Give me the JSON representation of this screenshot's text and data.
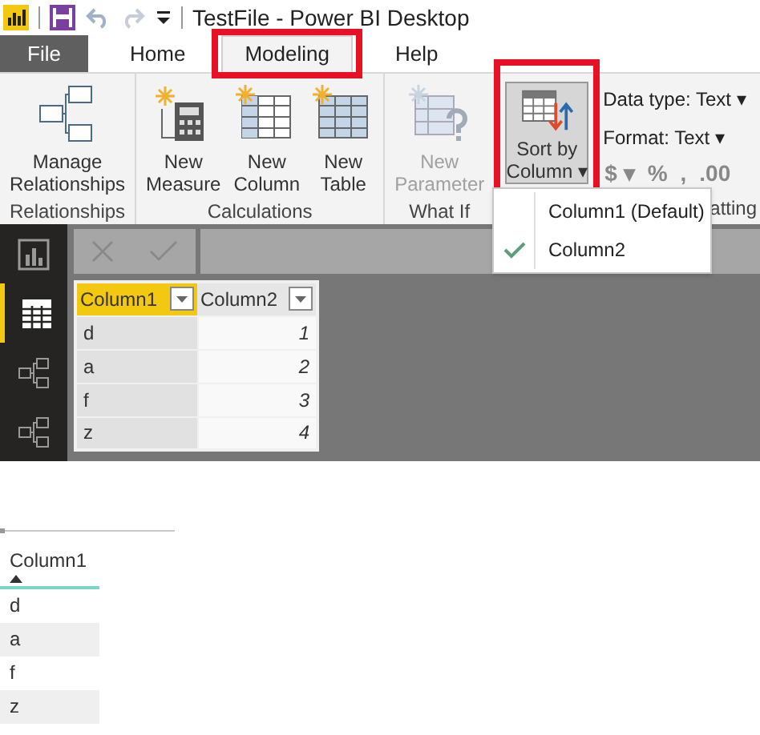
{
  "window": {
    "title": "TestFile - Power BI Desktop"
  },
  "tabs": [
    {
      "label": "File",
      "kind": "file",
      "selected": false,
      "highlighted": false
    },
    {
      "label": "Home",
      "kind": "tab",
      "selected": false,
      "highlighted": false
    },
    {
      "label": "Modeling",
      "kind": "tab",
      "selected": true,
      "highlighted": true
    },
    {
      "label": "Help",
      "kind": "tab",
      "selected": false,
      "highlighted": false
    }
  ],
  "ribbon": {
    "groups": [
      {
        "label": "Relationships",
        "buttons": [
          {
            "label": "Manage Relationships",
            "disabled": false
          }
        ]
      },
      {
        "label": "Calculations",
        "buttons": [
          {
            "label": "New Measure",
            "disabled": false
          },
          {
            "label": "New Column",
            "disabled": false
          },
          {
            "label": "New Table",
            "disabled": false
          }
        ]
      },
      {
        "label": "What If",
        "buttons": [
          {
            "label": "New Parameter",
            "disabled": true
          }
        ]
      }
    ],
    "sort_button": {
      "label": "Sort by Column",
      "caret": "▾",
      "pressed": true,
      "highlighted": true
    },
    "data_type": "Data type: Text ▾",
    "format": "Format: Text ▾",
    "format_symbols": [
      "$ ▾",
      "%",
      ",",
      ".00"
    ],
    "formatting_group_label": "atting"
  },
  "sort_menu": {
    "items": [
      {
        "label": "Column1 (Default)",
        "checked": false
      },
      {
        "label": "Column2",
        "checked": true
      }
    ]
  },
  "nav": [
    {
      "kind": "report",
      "selected": false
    },
    {
      "kind": "data",
      "selected": true
    },
    {
      "kind": "model",
      "selected": false
    },
    {
      "kind": "model",
      "selected": false
    }
  ],
  "data_grid": {
    "columns": [
      {
        "label": "Column1",
        "selected": true
      },
      {
        "label": "Column2",
        "selected": false
      }
    ],
    "rows": [
      [
        "d",
        "1"
      ],
      [
        "a",
        "2"
      ],
      [
        "f",
        "3"
      ],
      [
        "z",
        "4"
      ]
    ]
  },
  "visual": {
    "header": "Column1",
    "sort_ascending": true,
    "rows": [
      "d",
      "a",
      "f",
      "z"
    ]
  }
}
